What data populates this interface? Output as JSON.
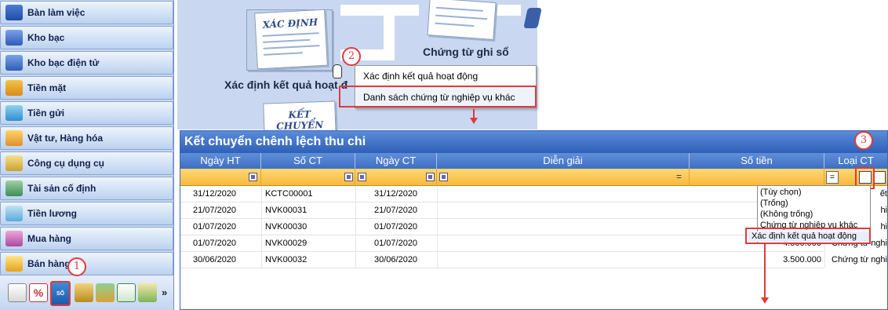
{
  "sidebar": {
    "items": [
      {
        "label": "Bàn làm việc",
        "icon": "desk-icon"
      },
      {
        "label": "Kho bạc",
        "icon": "treasury-icon"
      },
      {
        "label": "Kho bạc điện tử",
        "icon": "e-treasury-icon"
      },
      {
        "label": "Tiền mặt",
        "icon": "cash-icon"
      },
      {
        "label": "Tiền gửi",
        "icon": "deposit-icon"
      },
      {
        "label": "Vật tư, Hàng hóa",
        "icon": "goods-icon"
      },
      {
        "label": "Công cụ dụng cụ",
        "icon": "tools-icon"
      },
      {
        "label": "Tài sản cố định",
        "icon": "fixed-asset-icon"
      },
      {
        "label": "Tiền lương",
        "icon": "salary-icon"
      },
      {
        "label": "Mua hàng",
        "icon": "purchase-cart-icon"
      },
      {
        "label": "Bán hàng",
        "icon": "sales-icon"
      }
    ]
  },
  "toolbar": {
    "icons": [
      "report-icon",
      "percent-icon",
      "ledger-book-icon",
      "keys-icon",
      "books-stack-icon",
      "checklist-icon",
      "transfer-icon",
      "more-chevron-icon"
    ],
    "ledger_label": "SỔ CÁI",
    "more_glyph": "»"
  },
  "diagram": {
    "doc1_title": "XÁC ĐỊNH",
    "doc1_caption": "Xác định kết quả hoạt đ",
    "doc2_caption": "Chứng từ ghi sổ",
    "doc3_title": "KẾT CHUYỂN"
  },
  "context_menu": {
    "items": [
      "Xác định kết quả hoạt động",
      "Danh sách chứng từ nghiệp vụ khác"
    ]
  },
  "callouts": [
    "1",
    "2",
    "3"
  ],
  "panel": {
    "title": "Kết chuyển chênh lệch thu chi",
    "columns": [
      "Ngày HT",
      "Số CT",
      "Ngày CT",
      "Diễn giải",
      "Số tiền",
      "Loại CT"
    ],
    "filter_eq": "=",
    "rows": [
      {
        "ngay_ht": "31/12/2020",
        "so_ct": "KCTC00001",
        "ngay_ct": "31/12/2020",
        "so_tien": "",
        "loai_ct": "ết"
      },
      {
        "ngay_ht": "21/07/2020",
        "so_ct": "NVK00031",
        "ngay_ct": "21/07/2020",
        "so_tien": "",
        "loai_ct": "hi"
      },
      {
        "ngay_ht": "01/07/2020",
        "so_ct": "NVK00030",
        "ngay_ct": "01/07/2020",
        "so_tien": "",
        "loai_ct": "hi"
      },
      {
        "ngay_ht": "01/07/2020",
        "so_ct": "NVK00029",
        "ngay_ct": "01/07/2020",
        "so_tien": "4.500.000",
        "loai_ct": "Chứng từ nghi"
      },
      {
        "ngay_ht": "30/06/2020",
        "so_ct": "NVK00032",
        "ngay_ct": "30/06/2020",
        "so_tien": "3.500.000",
        "loai_ct": "Chứng từ nghi"
      }
    ]
  },
  "dropdown": {
    "options": [
      "(Tùy chọn)",
      "(Trống)",
      "(Không trống)",
      "Chứng từ nghiệp vụ khác",
      "Xác định kết quả hoạt động"
    ],
    "selected_index": 4
  },
  "colors": {
    "accent_red": "#e0393e",
    "panel_blue": "#2f60b8",
    "filter_orange": "#f8b93d"
  }
}
